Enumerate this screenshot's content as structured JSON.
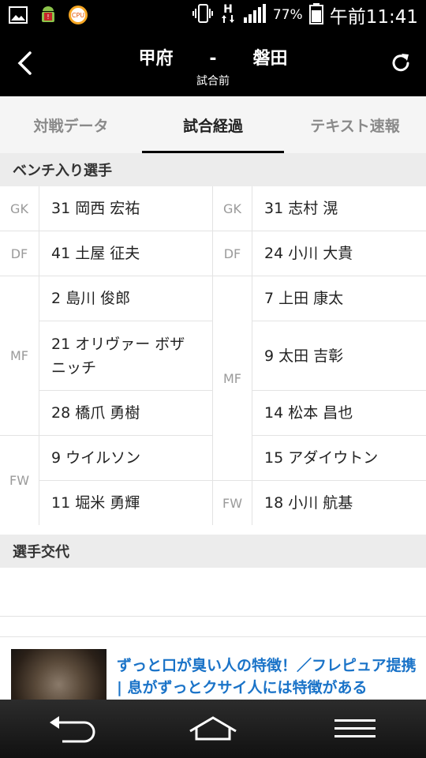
{
  "status_bar": {
    "battery": "77%",
    "time": "午前11:41",
    "cpu_label": "CPU",
    "icons": [
      "image-icon",
      "android-icon",
      "cpu-icon",
      "vibrate-icon",
      "data-h-icon",
      "signal-icon",
      "battery-icon"
    ]
  },
  "header": {
    "home_team": "甲府",
    "separator": "-",
    "away_team": "磐田",
    "status": "試合前"
  },
  "tabs": [
    {
      "label": "対戦データ",
      "active": false
    },
    {
      "label": "試合経過",
      "active": true
    },
    {
      "label": "テキスト速報",
      "active": false
    }
  ],
  "bench_section": {
    "title": "ベンチ入り選手"
  },
  "bench": {
    "home": {
      "gk_label": "GK",
      "gk": [
        "31 岡西 宏祐"
      ],
      "df_label": "DF",
      "df": [
        "41 土屋 征夫"
      ],
      "mf_label": "MF",
      "mf": [
        "2 島川 俊郎",
        "21 オリヴァー ボザニッチ",
        "28 橋爪 勇樹"
      ],
      "fw_label": "FW",
      "fw": [
        "9 ウイルソン",
        "11 堀米 勇輝"
      ]
    },
    "away": {
      "gk_label": "GK",
      "gk": [
        "31 志村 滉"
      ],
      "df_label": "DF",
      "df": [
        "24 小川 大貴"
      ],
      "mf_label": "MF",
      "mf": [
        "7 上田 康太",
        "9 太田 吉彰",
        "14 松本 昌也",
        "15 アダイウトン"
      ],
      "fw_label": "FW",
      "fw": [
        "18 小川 航基"
      ]
    }
  },
  "subs_section": {
    "title": "選手交代"
  },
  "ad": {
    "text": "ずっと口が臭い人の特徴！／フレピュア提携 | 息がずっとクサイ人には特徴がある"
  },
  "colors": {
    "header_bg": "#000000",
    "tab_bg": "#f5f5f5",
    "section_bg": "#ececec",
    "ad_link": "#1a73c8"
  }
}
